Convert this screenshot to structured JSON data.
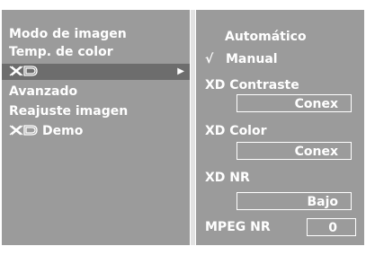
{
  "menu": {
    "items": [
      {
        "label": "Modo de imagen"
      },
      {
        "label": "Temp. de color"
      },
      {
        "label": "",
        "logo": "XD",
        "selected": true,
        "arrow": "▶"
      },
      {
        "label": "Avanzado"
      },
      {
        "label": "Reajuste imagen"
      },
      {
        "label": "Demo",
        "logo": "XD"
      }
    ]
  },
  "submenu": {
    "auto_label": "Automático",
    "check_mark": "√",
    "manual_label": "Manual",
    "contrast_label": "XD Contraste",
    "contrast_value": "Conex",
    "color_label": "XD Color",
    "color_value": "Conex",
    "nr_label": "XD NR",
    "nr_value": "Bajo",
    "mpeg_label": "MPEG NR",
    "mpeg_value": "0"
  },
  "colors": {
    "panel": "#9b9b9b",
    "divider": "#e2e2e2",
    "selection": "#6d6d6d",
    "text": "#ffffff"
  }
}
